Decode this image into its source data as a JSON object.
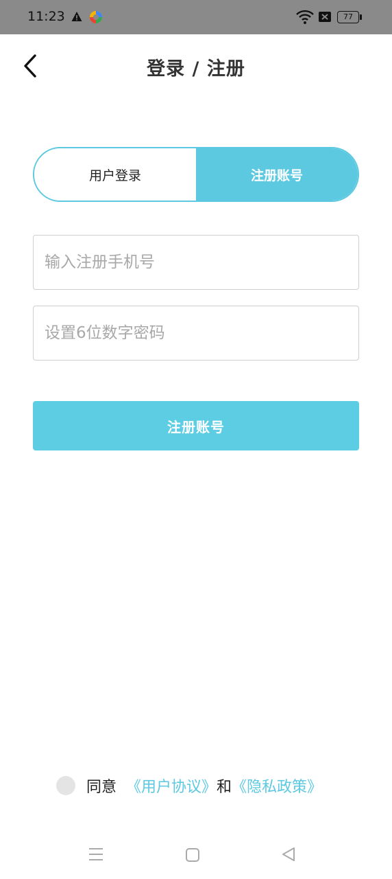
{
  "status_bar": {
    "time": "11:23",
    "battery": "77",
    "icons": [
      "warning-icon",
      "app-icon",
      "wifi-icon",
      "no-sim-icon",
      "battery-icon"
    ]
  },
  "header": {
    "title": "登录 / 注册",
    "back_icon": "chevron-left-icon"
  },
  "tabs": {
    "login_label": "用户登录",
    "register_label": "注册账号",
    "active": "register"
  },
  "form": {
    "phone_placeholder": "输入注册手机号",
    "phone_value": "",
    "password_placeholder": "设置6位数字密码",
    "password_value": "",
    "submit_label": "注册账号"
  },
  "agreement": {
    "agree_text": "同意",
    "user_agreement": "《用户协议》",
    "and_text": "和",
    "privacy_policy": "《隐私政策》",
    "checked": false
  },
  "colors": {
    "accent": "#5cc9e1",
    "status_bar": "#8a8a8a",
    "input_border": "#cfcfcf",
    "placeholder": "#a8a8a8"
  },
  "nav_bar": {
    "icons": [
      "menu-icon",
      "home-icon",
      "back-icon"
    ]
  }
}
